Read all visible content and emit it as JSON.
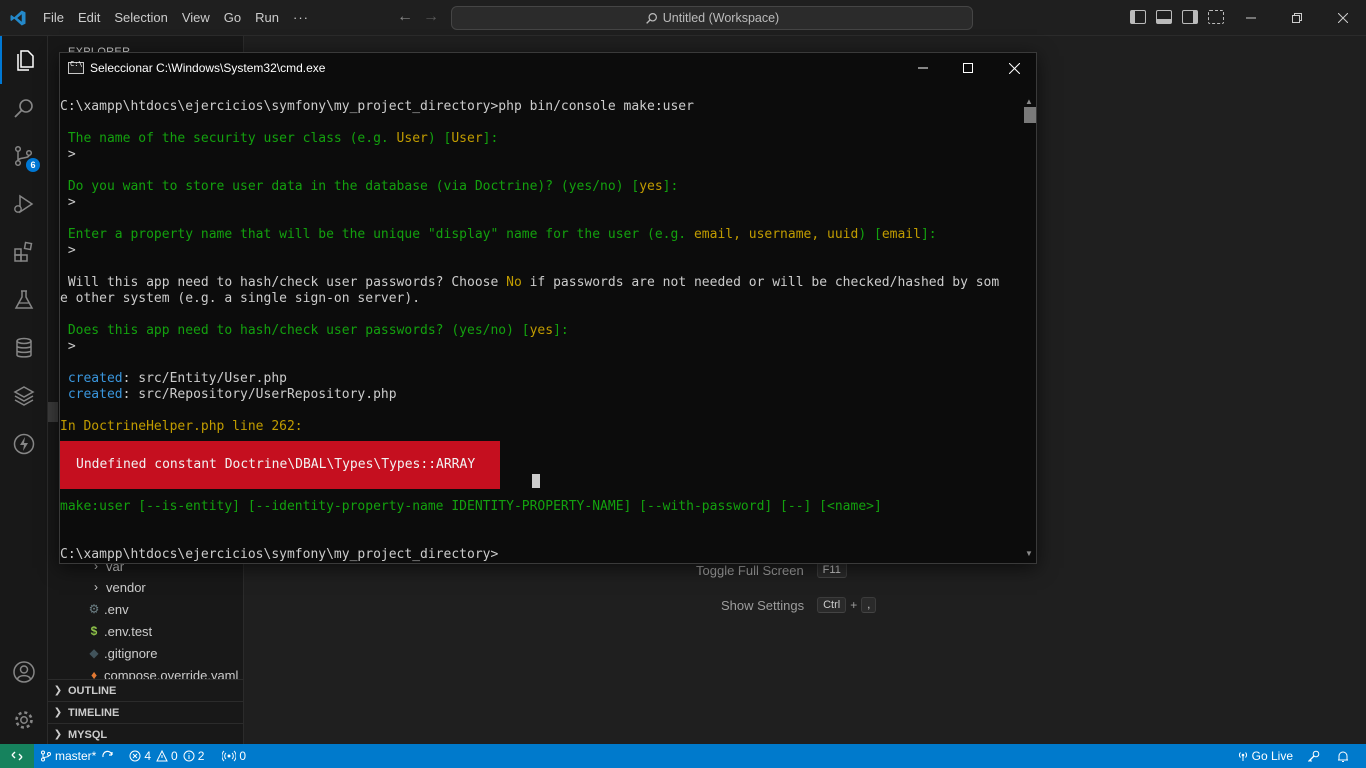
{
  "titlebar": {
    "menu": [
      "File",
      "Edit",
      "Selection",
      "View",
      "Go",
      "Run",
      "···"
    ],
    "search_text": "Untitled (Workspace)"
  },
  "activitybar": {
    "source_control_badge": "6"
  },
  "sidebar": {
    "title": "EXPLORER",
    "tree": [
      {
        "label": "var",
        "icon": "chevron-right-icon"
      },
      {
        "label": "vendor",
        "icon": "chevron-right-icon"
      },
      {
        "label": ".env",
        "icon": "gear-icon"
      },
      {
        "label": ".env.test",
        "icon": "dollar-icon"
      },
      {
        "label": ".gitignore",
        "icon": "git-diamond-icon"
      },
      {
        "label": "compose.override.yaml",
        "icon": "docker-icon"
      }
    ],
    "sections": [
      "OUTLINE",
      "TIMELINE",
      "MYSQL"
    ]
  },
  "editor": {
    "shortcuts": [
      {
        "label": "Toggle Full Screen",
        "keys": [
          "F11"
        ]
      },
      {
        "label": "Show Settings",
        "keys": [
          "Ctrl",
          ","
        ]
      }
    ]
  },
  "cmd": {
    "title": "Seleccionar C:\\Windows\\System32\\cmd.exe",
    "lines": {
      "l0": "C:\\xampp\\htdocs\\ejercicios\\symfony\\my_project_directory>php bin/console make:user",
      "l1a": " The name of the security user class (e.g. ",
      "l1b": "User",
      "l1c": ") [",
      "l1d": "User",
      "l1e": "]:",
      "l2": " >",
      "l3a": " Do you want to store user data in the database (via Doctrine)? (yes/no) [",
      "l3b": "yes",
      "l3c": "]:",
      "l4": " >",
      "l5a": " Enter a property name that will be the unique \"display\" name for the user (e.g. ",
      "l5b": "email, username, uuid",
      "l5c": ") [",
      "l5d": "email",
      "l5e": "]:",
      "l6": " >",
      "l7a": " Will this app need to hash/check user passwords? Choose ",
      "l7b": "No",
      "l7c": " if passwords are not needed or will be checked/hashed by som",
      "l8": "e other system (e.g. a single sign-on server).",
      "l9a": " Does this app need to hash/check user passwords? (yes/no) [",
      "l9b": "yes",
      "l9c": "]:",
      "l10": " >",
      "l11a": " created",
      "l11b": ": src/Entity/User.php",
      "l12a": " created",
      "l12b": ": src/Repository/UserRepository.php",
      "l13": "In DoctrineHelper.php line 262:",
      "error": "Undefined constant Doctrine\\DBAL\\Types\\Types::ARRAY",
      "l14": "make:user [--is-entity] [--identity-property-name IDENTITY-PROPERTY-NAME] [--with-password] [--] [<name>]",
      "l15": "C:\\xampp\\htdocs\\ejercicios\\symfony\\my_project_directory>"
    }
  },
  "statusbar": {
    "branch": "master*",
    "errors": "4",
    "warnings": "0",
    "info": "2",
    "ports": "0",
    "golive": "Go Live"
  },
  "colors": {
    "accent": "#007acc",
    "cmd_green": "#13a10e",
    "cmd_yellow": "#c19c00",
    "cmd_blue": "#3a96dd",
    "cmd_error_bg": "#c50f1f"
  }
}
